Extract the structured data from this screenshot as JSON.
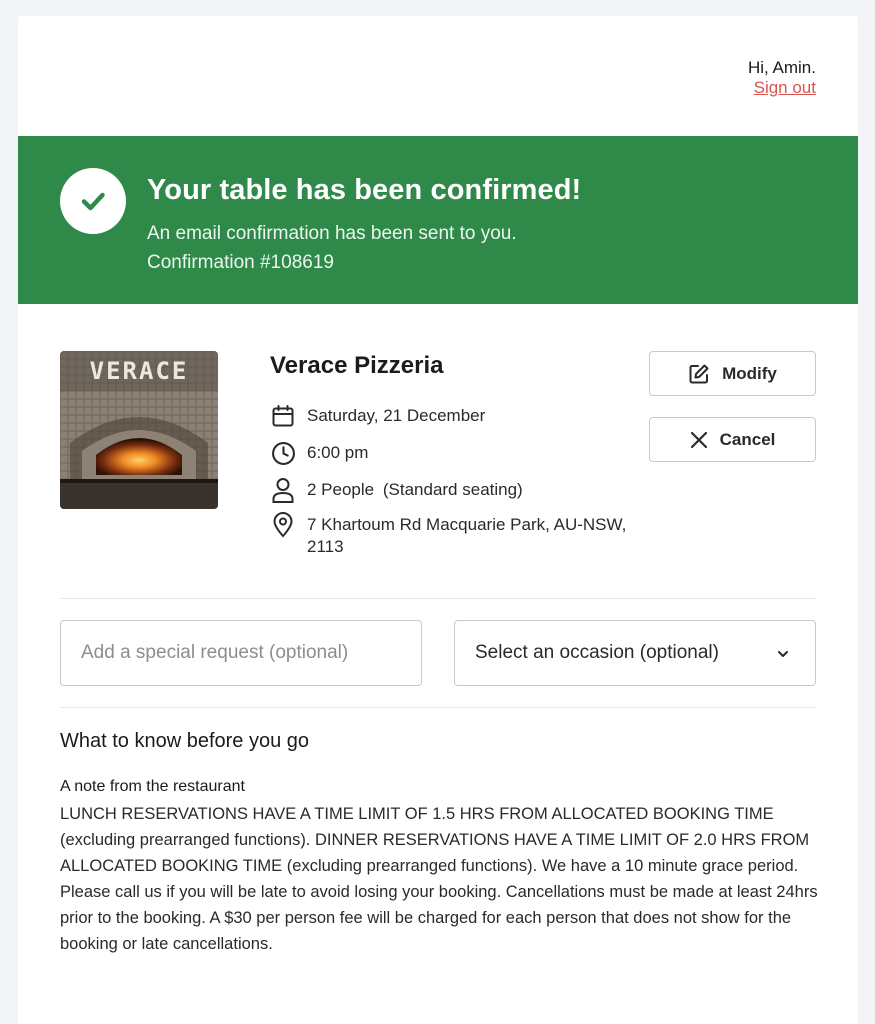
{
  "header": {
    "greeting": "Hi, Amin.",
    "sign_out": "Sign out"
  },
  "banner": {
    "title": "Your table has been confirmed!",
    "email_note": "An email confirmation has been sent to you.",
    "confirmation": "Confirmation #108619",
    "color": "#2f8a4a"
  },
  "restaurant": {
    "photo_sign": "VERACE",
    "name": "Verace Pizzeria",
    "date": "Saturday, 21 December",
    "time": "6:00 pm",
    "party": "2 People",
    "seating": "(Standard seating)",
    "address": "7 Khartoum Rd Macquarie Park, AU-NSW, 2113"
  },
  "actions": {
    "modify": "Modify",
    "cancel": "Cancel"
  },
  "form": {
    "special_request_placeholder": "Add a special request (optional)",
    "occasion_value": "Select an occasion (optional)"
  },
  "info": {
    "title": "What to know before you go",
    "note_title": "A note from the restaurant",
    "note_body": "LUNCH RESERVATIONS HAVE A TIME LIMIT OF 1.5 HRS FROM ALLOCATED BOOKING TIME (excluding prearranged functions). DINNER RESERVATIONS HAVE A TIME LIMIT OF 2.0 HRS FROM ALLOCATED BOOKING TIME (excluding prearranged functions). We have a 10 minute grace period. Please call us if you will be late to avoid losing your booking. Cancellations must be made at least 24hrs prior to the booking. A $30 per person fee will be charged for each person that does not show for the booking or late cancellations."
  }
}
